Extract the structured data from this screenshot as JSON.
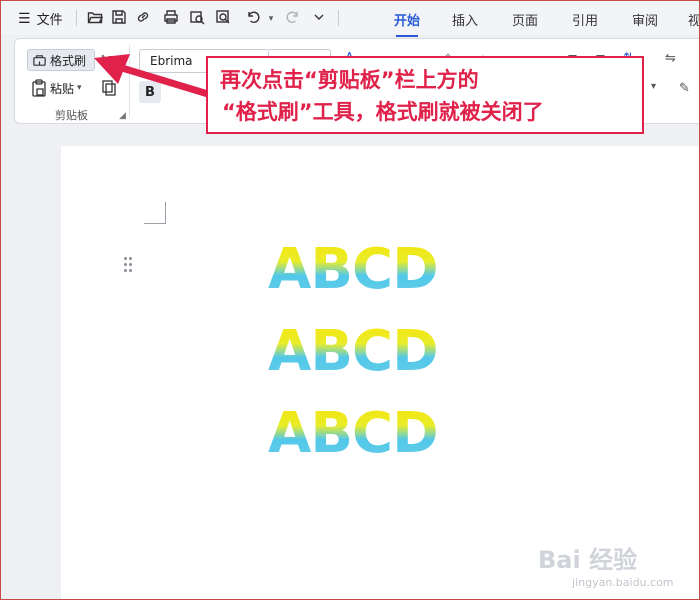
{
  "menu": {
    "label": "文件"
  },
  "tabs": [
    {
      "label": "开始",
      "active": true
    },
    {
      "label": "插入",
      "active": false
    },
    {
      "label": "页面",
      "active": false
    },
    {
      "label": "引用",
      "active": false
    },
    {
      "label": "审阅",
      "active": false
    },
    {
      "label": "视",
      "active": false
    }
  ],
  "clipboard": {
    "format_painter_label": "格式刷",
    "paste_label": "粘贴",
    "group_label": "剪贴板"
  },
  "font": {
    "name": "Ebrima",
    "bold_label": "B"
  },
  "callout": {
    "line1": "再次点击“剪贴板”栏上方的",
    "line2": "“格式刷”工具，格式刷就被关闭了",
    "color": "#e0224a"
  },
  "document": {
    "lines": [
      "ABCD",
      "ABCD",
      "ABCD"
    ],
    "gradient_colors": [
      "#f6e60e",
      "#52c8ea"
    ]
  },
  "watermark": {
    "logo": "Bai 经验",
    "url": "jingyan.baidu.com"
  },
  "icons": [
    "hamburger-icon",
    "folder-open-icon",
    "save-icon",
    "link-icon",
    "print-icon",
    "print-preview-icon",
    "find-icon",
    "undo-icon",
    "redo-icon",
    "chevron-down-icon",
    "format-painter-icon",
    "scissors-icon",
    "paste-icon",
    "copy-icon",
    "drag-handle-icon"
  ]
}
